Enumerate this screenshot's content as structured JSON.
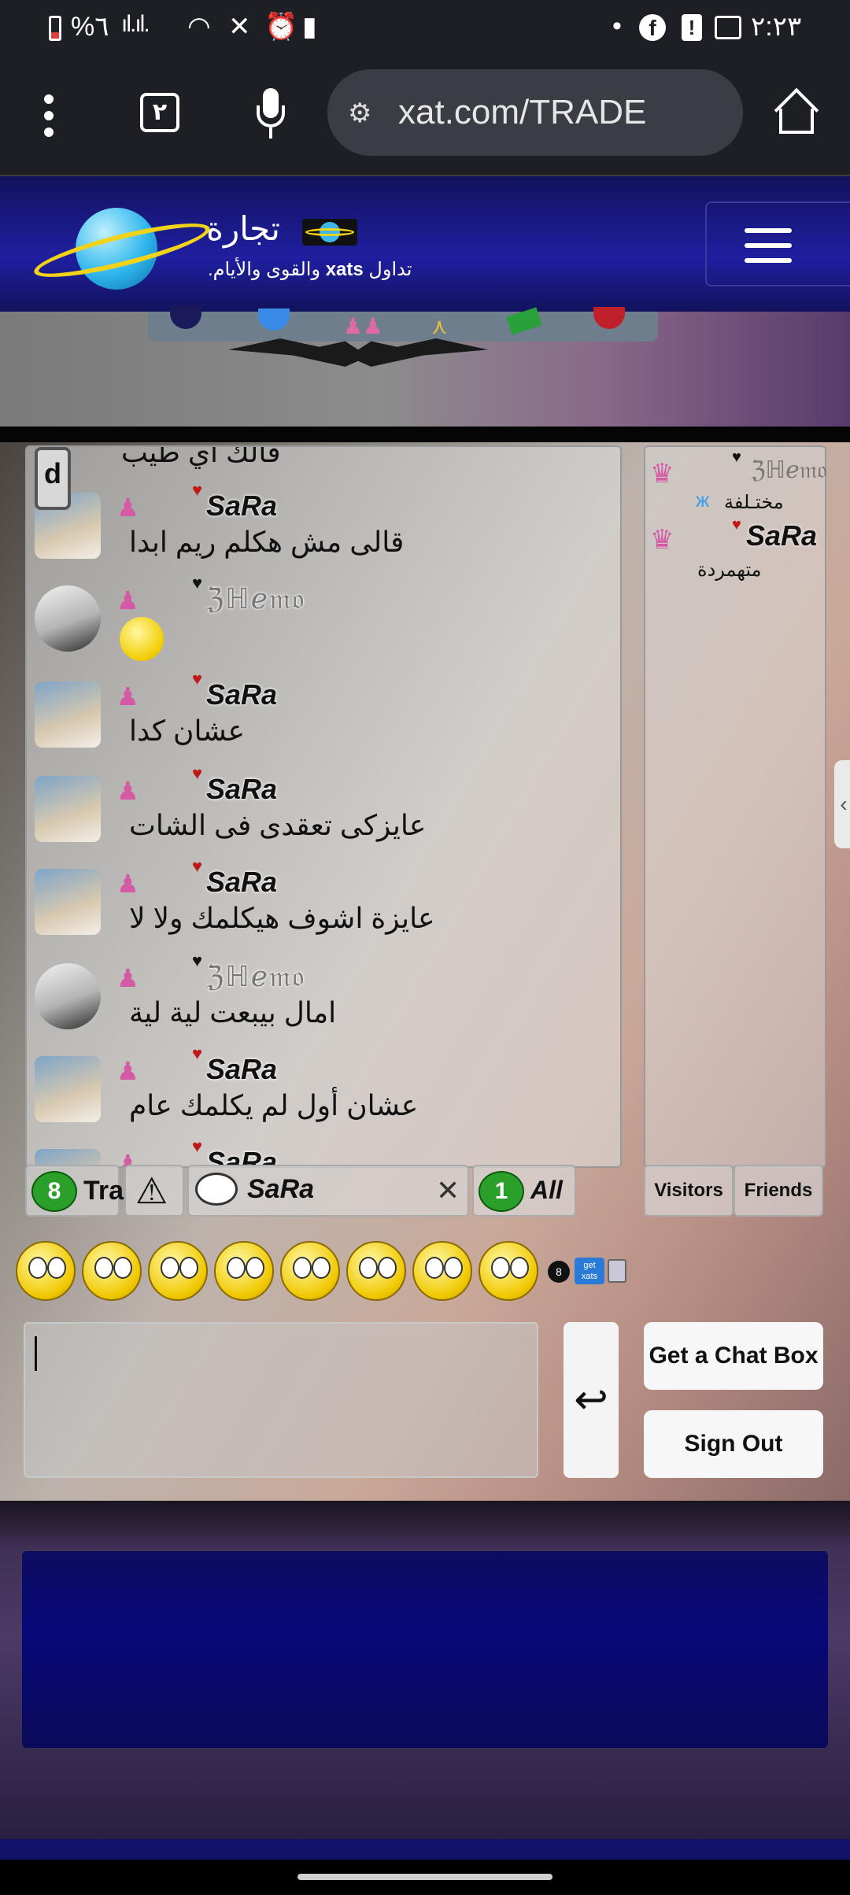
{
  "status_bar": {
    "battery_text": "%٦",
    "time": "٢:٢٣"
  },
  "browser": {
    "tab_count": "٢",
    "url": "xat.com/TRADE"
  },
  "site_header": {
    "title": "تجارة",
    "subtitle_prefix": "تداول",
    "subtitle_brand": "xats",
    "subtitle_suffix": "والقوى والأيام."
  },
  "chat": {
    "d_button": "d",
    "top_partial_text": "قالك اي طيب",
    "messages": [
      {
        "user": "SaRa",
        "text": "قالى مش هكلم ريم ابدا",
        "avatar": "blue",
        "heart": "red"
      },
      {
        "user": "ℨℍℯ𝔪𝔬",
        "text": "",
        "avatar": "gray",
        "heart": "black",
        "emoji": "surprised-smiley-icon"
      },
      {
        "user": "SaRa",
        "text": "عشان كدا",
        "avatar": "blue",
        "heart": "red"
      },
      {
        "user": "SaRa",
        "text": "عايزكى تعقدى فى الشات",
        "avatar": "blue",
        "heart": "red"
      },
      {
        "user": "SaRa",
        "text": "عايزة اشوف هيكلمك ولا لا",
        "avatar": "blue",
        "heart": "red"
      },
      {
        "user": "ℨℍℯ𝔪𝔬",
        "text": "امال بيبعت لية لية",
        "avatar": "gray",
        "heart": "black"
      },
      {
        "user": "SaRa",
        "text": "عشان أول لم يكلمك عام",
        "avatar": "blue",
        "heart": "red"
      },
      {
        "user": "SaRa",
        "text": "",
        "avatar": "blue",
        "heart": "red"
      }
    ],
    "user_list": [
      {
        "name": "ℨℍℯ𝔪𝔬",
        "status": "مختـلفة"
      },
      {
        "name": "SaRa",
        "status": "متهمردة"
      }
    ],
    "tabs": {
      "main_count": "8",
      "main_label": "Tra",
      "pm_user": "SaRa",
      "all_count": "1",
      "all_label": "All",
      "visitors": "Visitors",
      "friends": "Friends"
    },
    "smileys": [
      "smile",
      "smile",
      "eyebrow",
      "surprised",
      "wink",
      "cool",
      "crazy",
      "confused"
    ],
    "extras": {
      "ball": "8",
      "getxats": "get xats"
    },
    "buttons": {
      "send": "↩",
      "get_chat_box": "Get a Chat Box",
      "sign_out": "Sign Out"
    }
  }
}
